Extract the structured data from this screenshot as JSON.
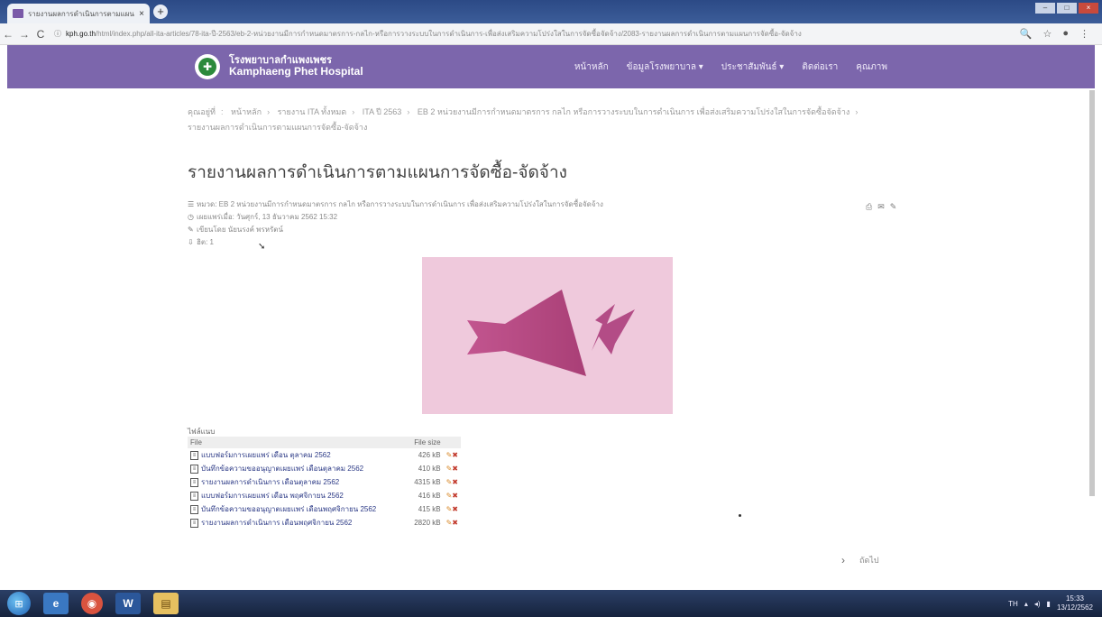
{
  "browser": {
    "tab_title": "รายงานผลการดำเนินการตามแผนการ",
    "tab_close": "×",
    "new_tab": "+",
    "url_domain": "kph.go.th",
    "url_path": "/html/index.php/all-ita-articles/78-ita-ปี-2563/eb-2-หน่วยงานมีการกำหนดมาตรการ-กลไก-หรือการวางระบบในการดำเนินการ-เพื่อส่งเสริมความโปร่งใสในการจัดซื้อจัดจ้าง/2083-รายงานผลการดำเนินการตามแผนการจัดซื้อ-จัดจ้าง",
    "back_icon": "←",
    "forward_icon": "→",
    "reload_icon": "C",
    "zoom_icon": "🔍",
    "star_icon": "☆",
    "menu_icon": "⋮"
  },
  "site": {
    "name_th": "โรงพยาบาลกำแพงเพชร",
    "name_en": "Kamphaeng Phet Hospital",
    "menu": [
      "หน้าหลัก",
      "ข้อมูลโรงพยาบาล ▾",
      "ประชาสัมพันธ์ ▾",
      "ติดต่อเรา",
      "คุณภาพ"
    ]
  },
  "breadcrumb": {
    "items": [
      "คุณอยู่ที่",
      "หน้าหลัก",
      "รายงาน ITA ทั้งหมด",
      "ITA ปี 2563",
      "EB 2 หน่วยงานมีการกำหนดมาตรการ กลไก หรือการวางระบบในการดำเนินการ เพื่อส่งเสริมความโปร่งใสในการจัดซื้อจัดจ้าง",
      "รายงานผลการดำเนินการตามแผนการจัดซื้อ-จัดจ้าง"
    ]
  },
  "article": {
    "title": "รายงานผลการดำเนินการตามแผนการจัดซื้อ-จัดจ้าง",
    "category": "หมวด: EB 2 หน่วยงานมีการกำหนดมาตรการ กลไก หรือการวางระบบในการดำเนินการ เพื่อส่งเสริมความโปร่งใสในการจัดซื้อจัดจ้าง",
    "published": "เผยแพร่เมื่อ: วันศุกร์, 13 ธันวาคม 2562 15:32",
    "author": "เขียนโดย นัยนรงค์ พรหรัตน์",
    "hits": "ฮิต: 1"
  },
  "attachments": {
    "title": "ไฟล์แนบ",
    "col_file": "File",
    "col_size": "File size",
    "rows": [
      {
        "name": "แบบฟอร์มการเผยแพร่ เดือน ตุลาคม 2562",
        "size": "426 kB"
      },
      {
        "name": "บันทึกข้อความขออนุญาตเผยแพร่ เดือนตุลาคม 2562",
        "size": "410 kB"
      },
      {
        "name": "รายงานผลการดำเนินการ เดือนตุลาคม 2562",
        "size": "4315 kB"
      },
      {
        "name": "แบบฟอร์มการเผยแพร่ เดือน พฤศจิกายน 2562",
        "size": "416 kB"
      },
      {
        "name": "บันทึกข้อความขออนุญาตเผยแพร่ เดือนพฤศจิกายน 2562",
        "size": "415 kB"
      },
      {
        "name": "รายงานผลการดำเนินการ เดือนพฤศจิกายน 2562",
        "size": "2820 kB"
      }
    ]
  },
  "pager": {
    "next_label": "ถัดไป"
  },
  "taskbar": {
    "lang": "TH",
    "time": "15:33",
    "date": "13/12/2562"
  },
  "colors": {
    "header": "#7c66ac",
    "hero_bg": "#efc9dc",
    "hero_shape": "#b9467f"
  }
}
